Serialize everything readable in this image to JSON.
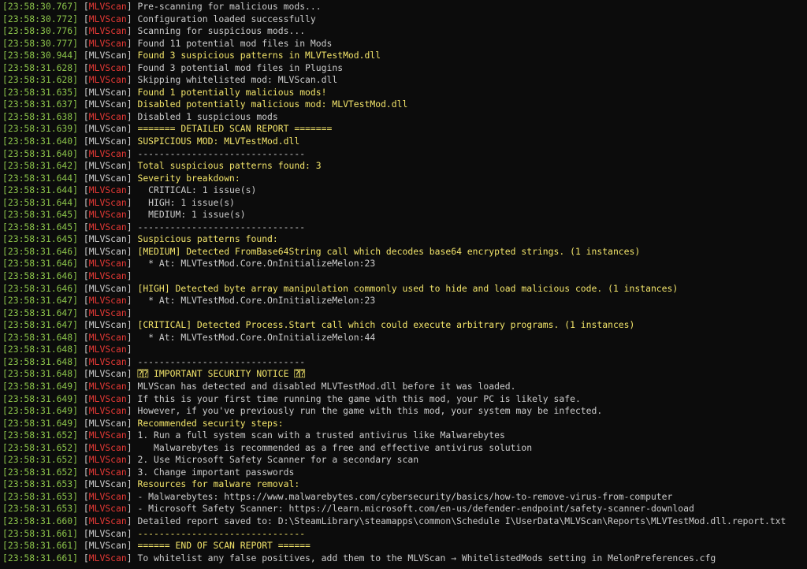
{
  "console": {
    "source_tag": "MLVScan",
    "lines": [
      {
        "time": "23:58:30.767",
        "tag_style": "red",
        "msg_style": "gray",
        "text": "Pre-scanning for malicious mods..."
      },
      {
        "time": "23:58:30.772",
        "tag_style": "red",
        "msg_style": "gray",
        "text": "Configuration loaded successfully"
      },
      {
        "time": "23:58:30.776",
        "tag_style": "red",
        "msg_style": "gray",
        "text": "Scanning for suspicious mods..."
      },
      {
        "time": "23:58:30.777",
        "tag_style": "red",
        "msg_style": "gray",
        "text": "Found 11 potential mod files in Mods"
      },
      {
        "time": "23:58:30.944",
        "tag_style": "white",
        "msg_style": "yellow",
        "text": "Found 3 suspicious patterns in MLVTestMod.dll"
      },
      {
        "time": "23:58:31.628",
        "tag_style": "red",
        "msg_style": "gray",
        "text": "Found 3 potential mod files in Plugins"
      },
      {
        "time": "23:58:31.628",
        "tag_style": "red",
        "msg_style": "gray",
        "text": "Skipping whitelisted mod: MLVScan.dll"
      },
      {
        "time": "23:58:31.635",
        "tag_style": "white",
        "msg_style": "yellow",
        "text": "Found 1 potentially malicious mods!"
      },
      {
        "time": "23:58:31.637",
        "tag_style": "white",
        "msg_style": "yellow",
        "text": "Disabled potentially malicious mod: MLVTestMod.dll"
      },
      {
        "time": "23:58:31.638",
        "tag_style": "red",
        "msg_style": "gray",
        "text": "Disabled 1 suspicious mods"
      },
      {
        "time": "23:58:31.639",
        "tag_style": "white",
        "msg_style": "yellow",
        "text": "======= DETAILED SCAN REPORT ======="
      },
      {
        "time": "23:58:31.640",
        "tag_style": "white",
        "msg_style": "yellow",
        "text": "SUSPICIOUS MOD: MLVTestMod.dll"
      },
      {
        "time": "23:58:31.640",
        "tag_style": "red",
        "msg_style": "gray",
        "text": "-------------------------------"
      },
      {
        "time": "23:58:31.642",
        "tag_style": "white",
        "msg_style": "yellow",
        "text": "Total suspicious patterns found: 3"
      },
      {
        "time": "23:58:31.644",
        "tag_style": "white",
        "msg_style": "yellow",
        "text": "Severity breakdown:"
      },
      {
        "time": "23:58:31.644",
        "tag_style": "red",
        "msg_style": "gray",
        "text": "  CRITICAL: 1 issue(s)"
      },
      {
        "time": "23:58:31.644",
        "tag_style": "red",
        "msg_style": "gray",
        "text": "  HIGH: 1 issue(s)"
      },
      {
        "time": "23:58:31.645",
        "tag_style": "red",
        "msg_style": "gray",
        "text": "  MEDIUM: 1 issue(s)"
      },
      {
        "time": "23:58:31.645",
        "tag_style": "red",
        "msg_style": "gray",
        "text": "-------------------------------"
      },
      {
        "time": "23:58:31.645",
        "tag_style": "white",
        "msg_style": "yellow",
        "text": "Suspicious patterns found:"
      },
      {
        "time": "23:58:31.646",
        "tag_style": "white",
        "msg_style": "yellow",
        "text": "[MEDIUM] Detected FromBase64String call which decodes base64 encrypted strings. (1 instances)"
      },
      {
        "time": "23:58:31.646",
        "tag_style": "red",
        "msg_style": "gray",
        "text": "  * At: MLVTestMod.Core.OnInitializeMelon:23"
      },
      {
        "time": "23:58:31.646",
        "tag_style": "red",
        "msg_style": "gray",
        "text": ""
      },
      {
        "time": "23:58:31.646",
        "tag_style": "white",
        "msg_style": "yellow",
        "text": "[HIGH] Detected byte array manipulation commonly used to hide and load malicious code. (1 instances)"
      },
      {
        "time": "23:58:31.647",
        "tag_style": "red",
        "msg_style": "gray",
        "text": "  * At: MLVTestMod.Core.OnInitializeMelon:23"
      },
      {
        "time": "23:58:31.647",
        "tag_style": "red",
        "msg_style": "gray",
        "text": ""
      },
      {
        "time": "23:58:31.647",
        "tag_style": "white",
        "msg_style": "yellow",
        "text": "[CRITICAL] Detected Process.Start call which could execute arbitrary programs. (1 instances)"
      },
      {
        "time": "23:58:31.648",
        "tag_style": "red",
        "msg_style": "gray",
        "text": "  * At: MLVTestMod.Core.OnInitializeMelon:44"
      },
      {
        "time": "23:58:31.648",
        "tag_style": "red",
        "msg_style": "gray",
        "text": ""
      },
      {
        "time": "23:58:31.648",
        "tag_style": "red",
        "msg_style": "gray",
        "text": "-------------------------------"
      },
      {
        "time": "23:58:31.648",
        "tag_style": "white",
        "msg_style": "yellow",
        "text": "⍰⍰ IMPORTANT SECURITY NOTICE ⍰⍰"
      },
      {
        "time": "23:58:31.649",
        "tag_style": "red",
        "msg_style": "gray",
        "text": "MLVScan has detected and disabled MLVTestMod.dll before it was loaded."
      },
      {
        "time": "23:58:31.649",
        "tag_style": "red",
        "msg_style": "gray",
        "text": "If this is your first time running the game with this mod, your PC is likely safe."
      },
      {
        "time": "23:58:31.649",
        "tag_style": "red",
        "msg_style": "gray",
        "text": "However, if you've previously run the game with this mod, your system may be infected."
      },
      {
        "time": "23:58:31.649",
        "tag_style": "white",
        "msg_style": "yellow",
        "text": "Recommended security steps:"
      },
      {
        "time": "23:58:31.652",
        "tag_style": "red",
        "msg_style": "gray",
        "text": "1. Run a full system scan with a trusted antivirus like Malwarebytes"
      },
      {
        "time": "23:58:31.652",
        "tag_style": "red",
        "msg_style": "gray",
        "text": "   Malwarebytes is recommended as a free and effective antivirus solution"
      },
      {
        "time": "23:58:31.652",
        "tag_style": "red",
        "msg_style": "gray",
        "text": "2. Use Microsoft Safety Scanner for a secondary scan"
      },
      {
        "time": "23:58:31.652",
        "tag_style": "red",
        "msg_style": "gray",
        "text": "3. Change important passwords"
      },
      {
        "time": "23:58:31.653",
        "tag_style": "white",
        "msg_style": "yellow",
        "text": "Resources for malware removal:"
      },
      {
        "time": "23:58:31.653",
        "tag_style": "red",
        "msg_style": "gray",
        "text": "- Malwarebytes: https://www.malwarebytes.com/cybersecurity/basics/how-to-remove-virus-from-computer"
      },
      {
        "time": "23:58:31.653",
        "tag_style": "red",
        "msg_style": "gray",
        "text": "- Microsoft Safety Scanner: https://learn.microsoft.com/en-us/defender-endpoint/safety-scanner-download"
      },
      {
        "time": "23:58:31.660",
        "tag_style": "red",
        "msg_style": "gray",
        "text": "Detailed report saved to: D:\\SteamLibrary\\steamapps\\common\\Schedule I\\UserData\\MLVScan\\Reports\\MLVTestMod.dll.report.txt"
      },
      {
        "time": "23:58:31.661",
        "tag_style": "white",
        "msg_style": "yellow",
        "text": "-------------------------------"
      },
      {
        "time": "23:58:31.661",
        "tag_style": "white",
        "msg_style": "yellow",
        "text": "====== END OF SCAN REPORT ======"
      },
      {
        "time": "23:58:31.661",
        "tag_style": "red",
        "msg_style": "gray",
        "text": "To whitelist any false positives, add them to the MLVScan → WhitelistedMods setting in MelonPreferences.cfg"
      }
    ]
  },
  "colors": {
    "background": "#0c0c0c",
    "timestamp": "#8bc34a",
    "tag_red": "#e53935",
    "text_gray": "#cccccc",
    "text_yellow": "#f2e46a"
  }
}
